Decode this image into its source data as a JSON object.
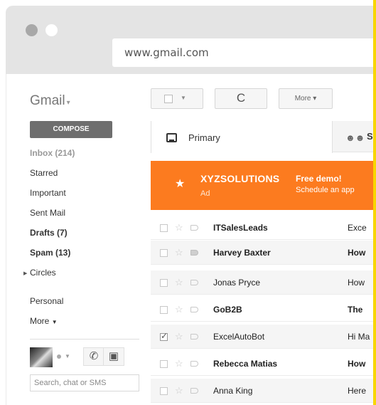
{
  "browser": {
    "url": "www.gmail.com"
  },
  "gmail": {
    "logo": "Gmail",
    "toolbar": {
      "refresh_glyph": "C",
      "more_label": "More"
    },
    "compose_label": "COMPOSE",
    "nav": {
      "inbox": "Inbox (214)",
      "starred": "Starred",
      "important": "Important",
      "sent": "Sent Mail",
      "drafts": "Drafts (7)",
      "spam": "Spam (13)",
      "circles": "Circles",
      "personal": "Personal",
      "more": "More"
    },
    "chat": {
      "search_placeholder": "Search, chat or SMS"
    },
    "tabs": {
      "primary": "Primary",
      "social_initial": "S"
    },
    "ad": {
      "brand": "XYZSOLUTIONS",
      "tag": "Ad",
      "headline": "Free demo!",
      "subline": "Schedule an app"
    },
    "emails": [
      {
        "sender": "ITSalesLeads",
        "subject": "Exce"
      },
      {
        "sender": "Harvey Baxter",
        "subject": "How"
      },
      {
        "sender": "Jonas Pryce",
        "subject": "How"
      },
      {
        "sender": "GoB2B",
        "subject": "The"
      },
      {
        "sender": "ExcelAutoBot",
        "subject": "Hi Ma"
      },
      {
        "sender": "Rebecca Matias",
        "subject": "How"
      },
      {
        "sender": "Anna King",
        "subject": "Here"
      }
    ]
  },
  "colors": {
    "ad_orange": "#fc7b1f",
    "compose_gray": "#6e6e6e",
    "highlight_yellow": "#f8d600"
  }
}
